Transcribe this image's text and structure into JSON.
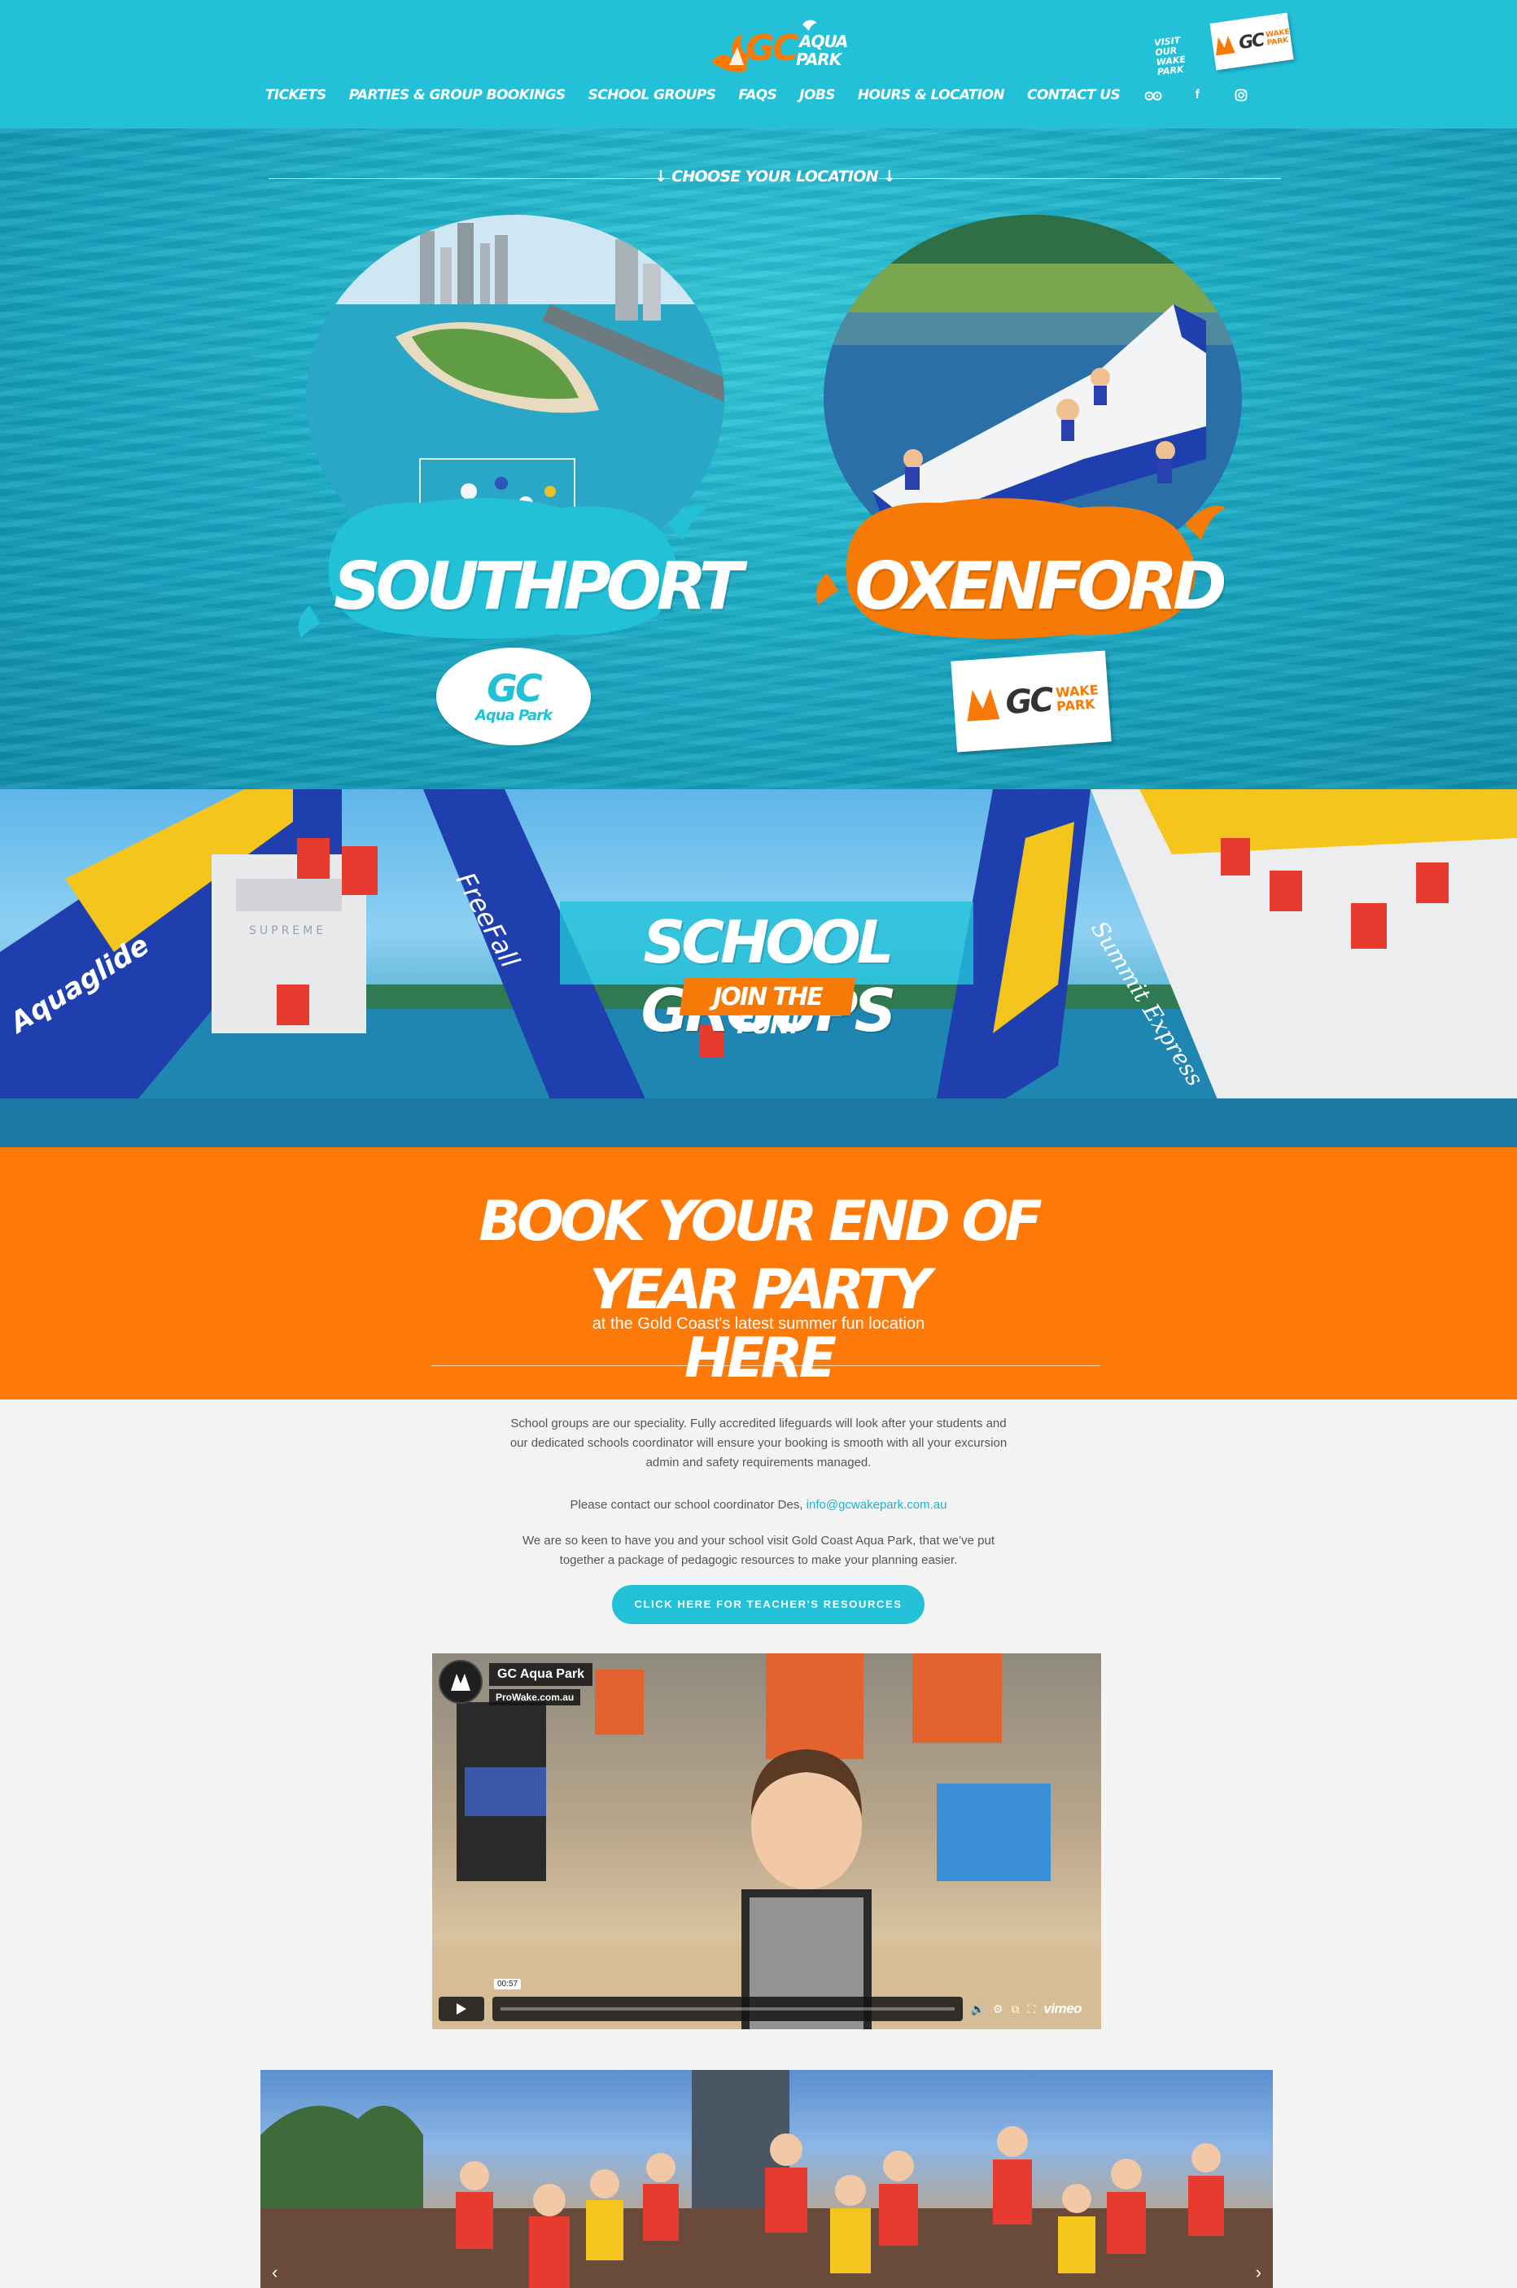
{
  "header": {
    "logo_text": "GC AQUA PARK",
    "nav": [
      {
        "label": "TICKETS"
      },
      {
        "label": "PARTIES & GROUP BOOKINGS"
      },
      {
        "label": "SCHOOL GROUPS"
      },
      {
        "label": "FAQS"
      },
      {
        "label": "JOBS"
      },
      {
        "label": "HOURS & LOCATION"
      },
      {
        "label": "CONTACT US"
      }
    ],
    "social": {
      "tripadvisor": "tripadvisor-icon",
      "facebook": "f",
      "instagram": "instagram-icon"
    },
    "visit_wake": {
      "line1": "VISIT OUR",
      "line2": "WAKE PARK",
      "badge_gc": "GC",
      "badge_word1": "WAKE",
      "badge_word2": "PARK"
    }
  },
  "locations": {
    "heading": "↓ CHOOSE YOUR LOCATION ↓",
    "cards": [
      {
        "name": "SOUTHPORT",
        "logo_gc": "GC",
        "logo_sub": "Aqua Park",
        "color": "#22c1d8"
      },
      {
        "name": "OXENFORD",
        "logo_gc": "GC",
        "logo_word1": "WAKE",
        "logo_word2": "PARK",
        "color": "#f87a06"
      }
    ]
  },
  "banner": {
    "title": "SCHOOL GROUPS",
    "subtitle": "JOIN THE FUN!",
    "slide_labels": {
      "left": "Aquaglide",
      "center": "FreeFall",
      "right": "Summit Express",
      "panel": "SUPREME"
    }
  },
  "cta_section": {
    "title_line1": "BOOK YOUR END OF YEAR PARTY",
    "title_line2": "HERE",
    "subtitle": "at the Gold Coast's latest summer fun location"
  },
  "body": {
    "para1": "School groups are our speciality. Fully accredited lifeguards will look after your students and our dedicated schools coordinator will ensure your booking is smooth with all your excursion admin and safety requirements managed.",
    "para2_prefix": "Please contact our school coordinator Des, ",
    "email": "info@gcwakepark.com.au",
    "para3": "We are so keen to have you and your school visit Gold Coast Aqua Park, that we’ve put together a package of pedagogic resources to make your planning easier.",
    "button": "CLICK HERE FOR TEACHER'S RESOURCES"
  },
  "video": {
    "channel": "GC Aqua Park",
    "byline": "ProWake.com.au",
    "time": "00:57",
    "brand": "vimeo"
  },
  "gallery": {
    "prev": "‹",
    "next": "›"
  },
  "colors": {
    "teal": "#22c1d8",
    "orange": "#fd7a08",
    "page_bg": "#f4f4f4",
    "text": "#555555",
    "link": "#1eb3cc"
  }
}
